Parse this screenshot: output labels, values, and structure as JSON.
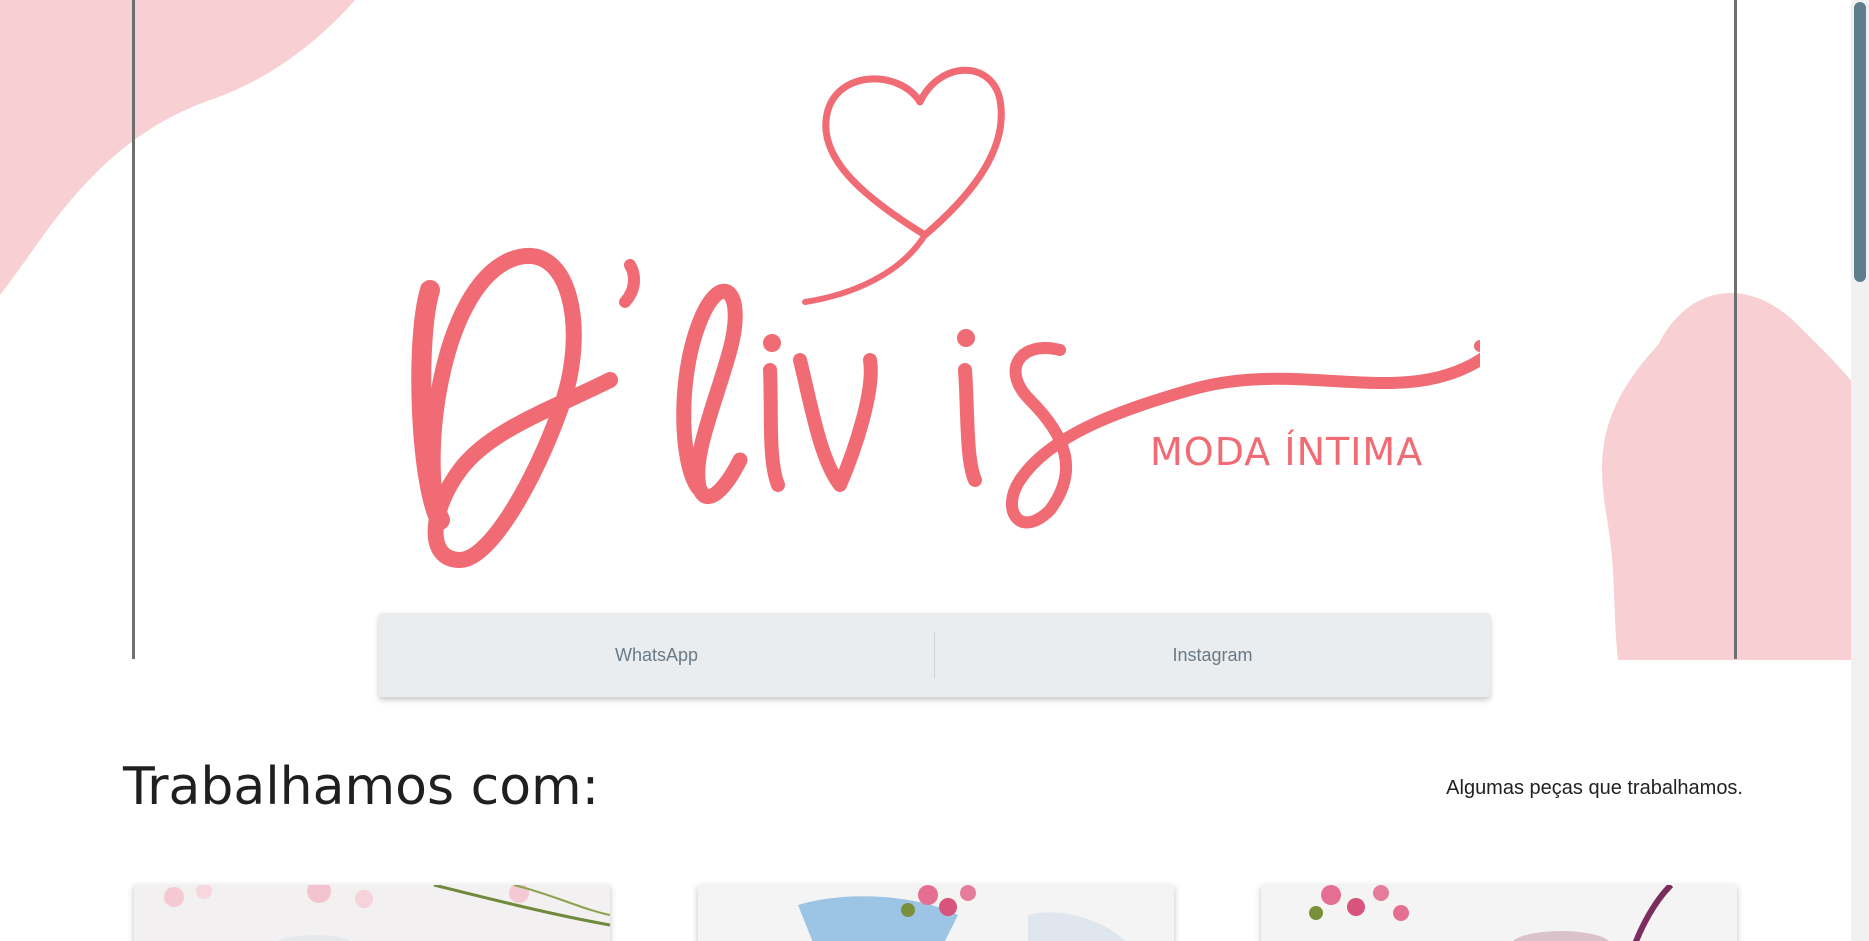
{
  "brand": {
    "logo_script": "D'livis",
    "tagline": "MODA ÍNTIMA",
    "accent_color": "#f06b73",
    "blob_color": "#f8cfd2"
  },
  "links": {
    "whatsapp_label": "WhatsApp",
    "instagram_label": "Instagram"
  },
  "section": {
    "title": "Trabalhamos com:",
    "subtitle": "Algumas peças que trabalhamos."
  },
  "cards": [
    {
      "name": "product-card-1"
    },
    {
      "name": "product-card-2"
    },
    {
      "name": "product-card-3"
    }
  ]
}
